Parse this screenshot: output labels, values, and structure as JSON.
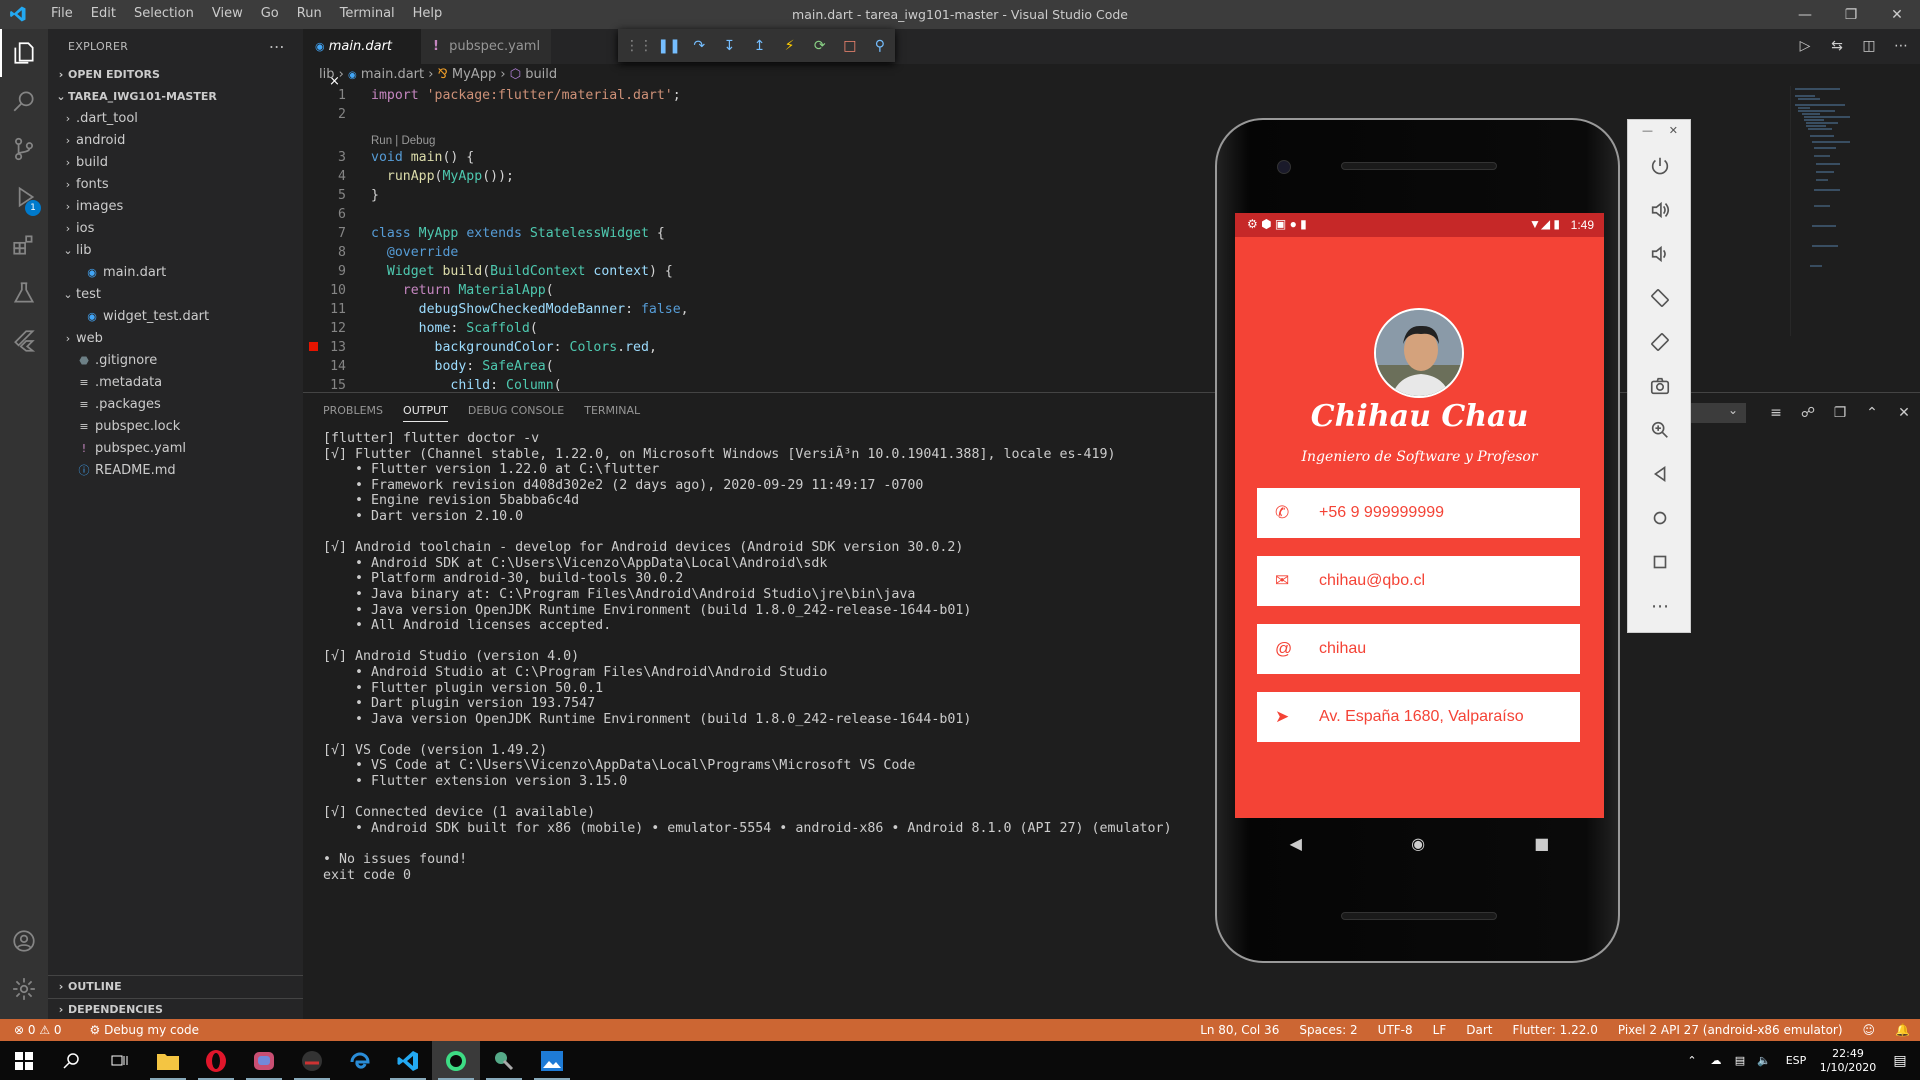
{
  "window": {
    "title": "main.dart - tarea_iwg101-master - Visual Studio Code",
    "menu": [
      "File",
      "Edit",
      "Selection",
      "View",
      "Go",
      "Run",
      "Terminal",
      "Help"
    ]
  },
  "sidebar": {
    "title": "EXPLORER",
    "open_editors": "OPEN EDITORS",
    "project": "TAREA_IWG101-MASTER",
    "items": [
      {
        "label": ".dart_tool",
        "type": "folder",
        "depth": 0,
        "open": false
      },
      {
        "label": "android",
        "type": "folder",
        "depth": 0,
        "open": false
      },
      {
        "label": "build",
        "type": "folder",
        "depth": 0,
        "open": false
      },
      {
        "label": "fonts",
        "type": "folder",
        "depth": 0,
        "open": false
      },
      {
        "label": "images",
        "type": "folder",
        "depth": 0,
        "open": false
      },
      {
        "label": "ios",
        "type": "folder",
        "depth": 0,
        "open": false
      },
      {
        "label": "lib",
        "type": "folder",
        "depth": 0,
        "open": true
      },
      {
        "label": "main.dart",
        "type": "dart",
        "depth": 1
      },
      {
        "label": "test",
        "type": "folder",
        "depth": 0,
        "open": true
      },
      {
        "label": "widget_test.dart",
        "type": "dart",
        "depth": 1
      },
      {
        "label": "web",
        "type": "folder",
        "depth": 0,
        "open": false
      },
      {
        "label": ".gitignore",
        "type": "git",
        "depth": 0
      },
      {
        "label": ".metadata",
        "type": "text",
        "depth": 0
      },
      {
        "label": ".packages",
        "type": "text",
        "depth": 0
      },
      {
        "label": "pubspec.lock",
        "type": "text",
        "depth": 0
      },
      {
        "label": "pubspec.yaml",
        "type": "yaml",
        "depth": 0
      },
      {
        "label": "README.md",
        "type": "info",
        "depth": 0
      }
    ],
    "outline": "OUTLINE",
    "dependencies": "DEPENDENCIES"
  },
  "tabs": [
    {
      "label": "main.dart",
      "active": true,
      "close": "×"
    },
    {
      "label": "pubspec.yaml",
      "active": false
    }
  ],
  "breadcrumb": {
    "a": "lib",
    "b": "main.dart",
    "c": "MyApp",
    "d": "build"
  },
  "code": {
    "lens": "Run | Debug",
    "lines": [
      "1",
      "2",
      "3",
      "4",
      "5",
      "6",
      "7",
      "8",
      "9",
      "10",
      "11",
      "12",
      "13",
      "14",
      "15"
    ]
  },
  "panel": {
    "tabs": [
      "PROBLEMS",
      "OUTPUT",
      "DEBUG CONSOLE",
      "TERMINAL"
    ],
    "output": [
      "[flutter] flutter doctor -v",
      "[√] Flutter (Channel stable, 1.22.0, on Microsoft Windows [VersiÃ³n 10.0.19041.388], locale es-419)",
      "    • Flutter version 1.22.0 at C:\\flutter",
      "    • Framework revision d408d302e2 (2 days ago), 2020-09-29 11:49:17 -0700",
      "    • Engine revision 5babba6c4d",
      "    • Dart version 2.10.0",
      "",
      "[√] Android toolchain - develop for Android devices (Android SDK version 30.0.2)",
      "    • Android SDK at C:\\Users\\Vicenzo\\AppData\\Local\\Android\\sdk",
      "    • Platform android-30, build-tools 30.0.2",
      "    • Java binary at: C:\\Program Files\\Android\\Android Studio\\jre\\bin\\java",
      "    • Java version OpenJDK Runtime Environment (build 1.8.0_242-release-1644-b01)",
      "    • All Android licenses accepted.",
      "",
      "[√] Android Studio (version 4.0)",
      "    • Android Studio at C:\\Program Files\\Android\\Android Studio",
      "    • Flutter plugin version 50.0.1",
      "    • Dart plugin version 193.7547",
      "    • Java version OpenJDK Runtime Environment (build 1.8.0_242-release-1644-b01)",
      "",
      "[√] VS Code (version 1.49.2)",
      "    • VS Code at C:\\Users\\Vicenzo\\AppData\\Local\\Programs\\Microsoft VS Code",
      "    • Flutter extension version 3.15.0",
      "",
      "[√] Connected device (1 available)",
      "    • Android SDK built for x86 (mobile) • emulator-5554 • android-x86 • Android 8.1.0 (API 27) (emulator)",
      "",
      "• No issues found!",
      "exit code 0"
    ]
  },
  "statusbar": {
    "errors": "0",
    "warnings": "0",
    "launch": "Debug my code",
    "position": "Ln 80, Col 36",
    "spaces": "Spaces: 2",
    "encoding": "UTF-8",
    "eol": "LF",
    "language": "Dart",
    "flutter": "Flutter: 1.22.0",
    "device": "Pixel 2 API 27 (android-x86 emulator)",
    "color": "#cc6633"
  },
  "phone": {
    "time": "1:49",
    "name": "Chihau Chau",
    "subtitle": "Ingeniero de Software y Profesor",
    "cards": [
      {
        "icon": "phone-icon",
        "text": "+56 9 999999999"
      },
      {
        "icon": "mail-icon",
        "text": "chihau@qbo.cl"
      },
      {
        "icon": "at-icon",
        "text": "chihau"
      },
      {
        "icon": "directions-icon",
        "text": "Av. España 1680, Valparaíso"
      }
    ],
    "accent": "#f44336"
  },
  "taskbar": {
    "lang": "ESP",
    "time": "22:49",
    "date": "1/10/2020"
  }
}
